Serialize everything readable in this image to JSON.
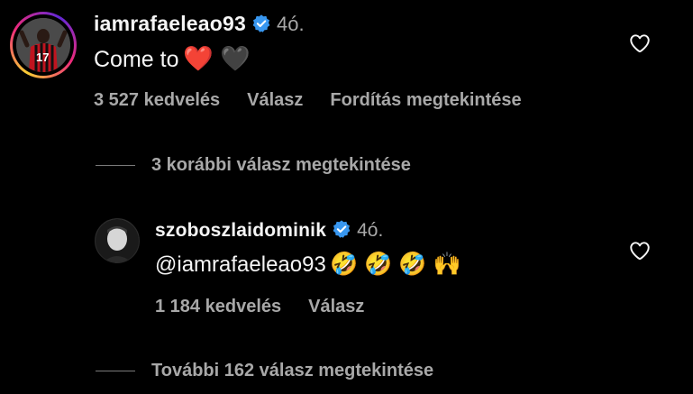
{
  "comment": {
    "username": "iamrafaeleao93",
    "time": "4ó.",
    "text": "Come to",
    "emojis": "❤️ 🖤",
    "likes": "3 527 kedvelés",
    "reply": "Válasz",
    "translate": "Fordítás megtekintése"
  },
  "replies_toggle_1": "3 korábbi válasz megtekintése",
  "reply": {
    "username": "szoboszlaidominik",
    "time": "4ó.",
    "text": "@iamrafaeleao93",
    "emojis": "🤣 🤣 🤣 🙌",
    "likes": "1 184 kedvelés",
    "reply": "Válasz"
  },
  "replies_toggle_2": "További 162 válasz megtekintése",
  "colors": {
    "background": "#000000",
    "verified": "#3897f0",
    "secondary_text": "#a8a8a8"
  }
}
